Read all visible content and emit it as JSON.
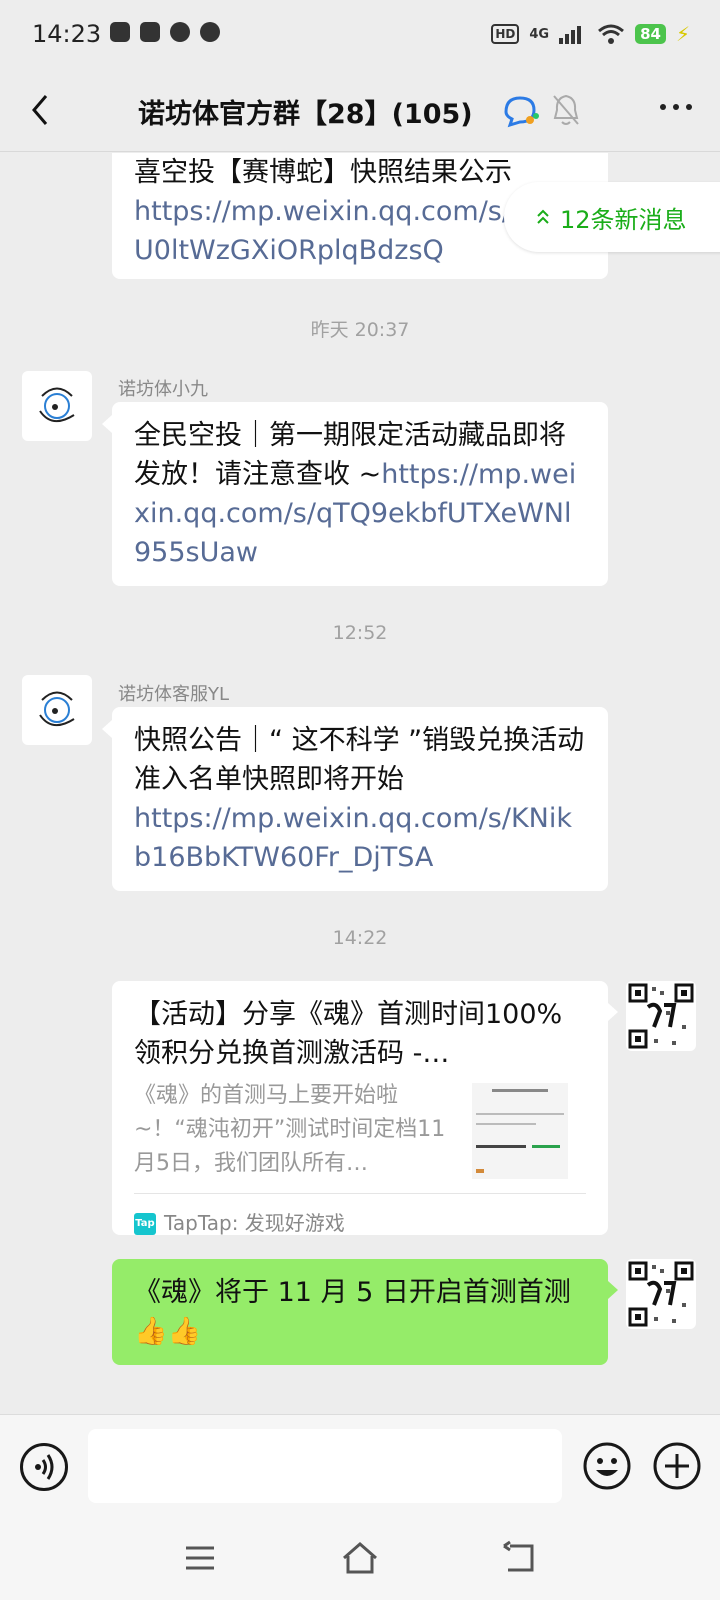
{
  "status": {
    "time": "14:23",
    "hd": "HD",
    "network": "4G",
    "battery": "84"
  },
  "header": {
    "title": "诺坊体官方群【28】(105)"
  },
  "new_messages": {
    "label": "12条新消息"
  },
  "messages": {
    "m0": {
      "text": "喜空投【赛博蛇】快照结果公示",
      "link": "https://mp.weixin.qq.com/s/d2OU0ltWzGXiORplqBdzsQ"
    },
    "t1": "昨天 20:37",
    "m1": {
      "sender": "诺坊体小九",
      "text": "全民空投｜第一期限定活动藏品即将发放！请注意查收 ~",
      "link": "https://mp.weixin.qq.com/s/qTQ9ekbfUTXeWNl955sUaw"
    },
    "t2": "12:52",
    "m2": {
      "sender": "诺坊体客服YL",
      "text": "快照公告｜“ 这不科学 ”销毁兑换活动准入名单快照即将开始",
      "link": "https://mp.weixin.qq.com/s/KNikb16BbKTW60Fr_DjTSA"
    },
    "t3": "14:22",
    "m3": {
      "title": "【活动】分享《魂》首测时间100%领积分兑换首测激活码 -…",
      "desc": "《魂》的首测马上要开始啦~！“魂沌初开”测试时间定档11月5日，我们团队所有…",
      "source": "TapTap: 发现好游戏"
    },
    "m4": {
      "text": "《魂》将于 11 月 5 日开启首测首测👍👍"
    }
  },
  "colors": {
    "accent": "#1aad19",
    "link": "#576b95",
    "self_bubble": "#95ec69"
  }
}
